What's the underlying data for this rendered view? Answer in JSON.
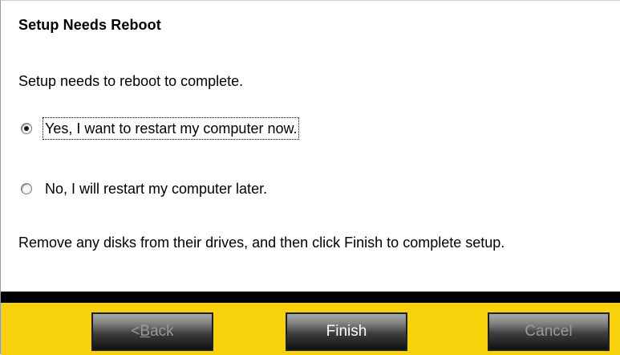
{
  "dialog": {
    "title": "Setup Needs Reboot",
    "message": "Setup needs to reboot to complete.",
    "options": [
      {
        "label": "Yes, I want to restart my computer now.",
        "selected": true
      },
      {
        "label": "No, I will restart my computer later.",
        "selected": false
      }
    ],
    "note": "Remove any disks from their drives, and then click Finish to complete setup."
  },
  "buttons": {
    "back_prefix": "< ",
    "back_accel": "B",
    "back_rest": "ack",
    "finish": "Finish",
    "cancel": "Cancel"
  },
  "colors": {
    "footer": "#f7d10a",
    "bar": "#000000"
  }
}
